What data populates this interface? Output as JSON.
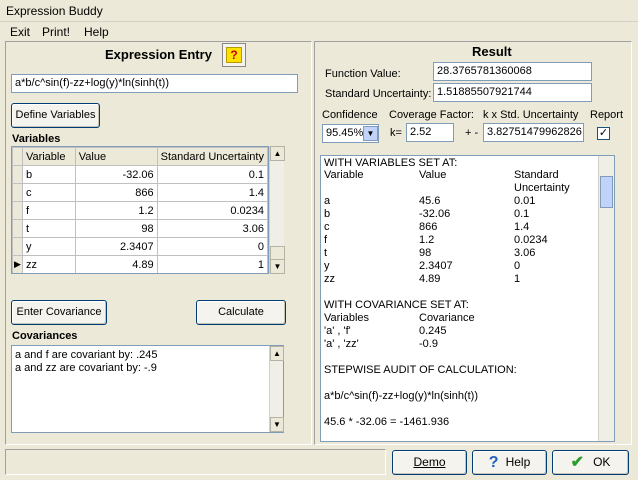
{
  "window": {
    "title": "Expression Buddy"
  },
  "menu": [
    "Exit",
    "Print!",
    "Help"
  ],
  "left": {
    "heading": "Expression Entry",
    "help_glyph": "?",
    "expression": "a*b/c^sin(f)-zz+log(y)*ln(sinh(t))",
    "define_btn": "Define Variables",
    "variables_label": "Variables",
    "grid_headers": [
      "Variable",
      "Value",
      "Standard Uncertainty"
    ],
    "grid_rows": [
      {
        "name": "b",
        "value": "-32.06",
        "unc": "0.1"
      },
      {
        "name": "c",
        "value": "866",
        "unc": "1.4"
      },
      {
        "name": "f",
        "value": "1.2",
        "unc": "0.0234"
      },
      {
        "name": "t",
        "value": "98",
        "unc": "3.06"
      },
      {
        "name": "y",
        "value": "2.3407",
        "unc": "0"
      },
      {
        "name": "zz",
        "value": "4.89",
        "unc": "1"
      }
    ],
    "enter_cov_btn": "Enter Covariance",
    "calculate_btn": "Calculate",
    "cov_label": "Covariances",
    "cov_lines": [
      "a and f are covariant by: .245",
      "a and zz are covariant by: -.9"
    ]
  },
  "right": {
    "heading": "Result",
    "function_value_label": "Function Value:",
    "function_value": "28.3765781360068",
    "std_unc_label": "Standard Uncertainty:",
    "std_unc": "1.51885507921744",
    "confidence_label": "Confidence",
    "confidence_value": "95.45%",
    "coverage_label": "Coverage Factor:",
    "k_label": "k=",
    "k_value": "2.52",
    "kstd_label": "k x Std. Uncertainty",
    "pm_label": "+ -",
    "kstd_value": "3.82751479962826",
    "report_label": "Report",
    "report_checked": "✓",
    "output": {
      "vars_header": "WITH VARIABLES SET AT:",
      "col_variable": "Variable",
      "col_value": "Value",
      "col_std1": "Standard",
      "col_std2": "Uncertainty",
      "var_rows": [
        {
          "n": "a",
          "v": "45.6",
          "u": "0.01"
        },
        {
          "n": "b",
          "v": "-32.06",
          "u": "0.1"
        },
        {
          "n": "c",
          "v": "866",
          "u": "1.4"
        },
        {
          "n": "f",
          "v": "1.2",
          "u": "0.0234"
        },
        {
          "n": "t",
          "v": "98",
          "u": "3.06"
        },
        {
          "n": "y",
          "v": "2.3407",
          "u": "0"
        },
        {
          "n": "zz",
          "v": "4.89",
          "u": "1"
        }
      ],
      "cov_header": "WITH COVARIANCE SET AT:",
      "cov_col1": "Variables",
      "cov_col2": "Covariance",
      "cov_rows": [
        {
          "p": "'a' , 'f'",
          "c": "0.245"
        },
        {
          "p": "'a' , 'zz'",
          "c": "-0.9"
        }
      ],
      "audit_header": "STEPWISE AUDIT OF CALCULATION:",
      "audit_expr": "a*b/c^sin(f)-zz+log(y)*ln(sinh(t))",
      "audit_step": "45.6 * -32.06 = -1461.936"
    }
  },
  "footer": {
    "demo_btn": "Demo",
    "help_btn": "Help",
    "ok_btn": "OK",
    "help_glyph": "?",
    "ok_glyph": "✔"
  },
  "colors": {
    "help_yellow": "#ffe000",
    "help_red": "#cc0000",
    "ok_green": "#2e9b2e",
    "blue_q": "#1f5fbf"
  }
}
